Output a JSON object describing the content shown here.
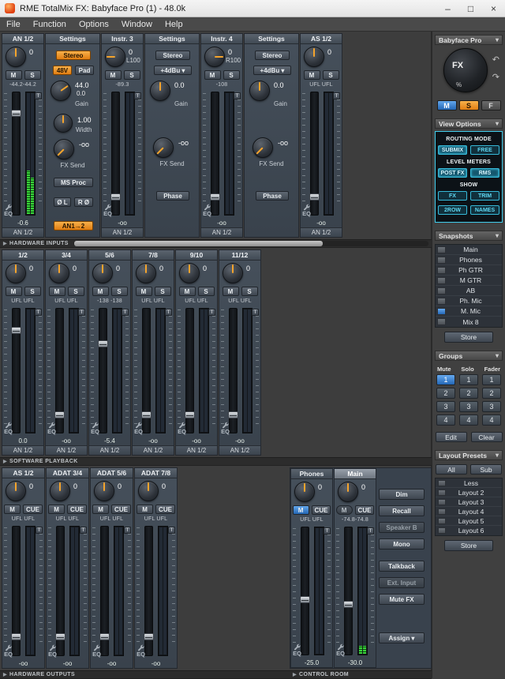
{
  "titlebar": {
    "title": "RME TotalMix FX: Babyface Pro (1) - 48.0k",
    "controls": [
      "–",
      "□",
      "×"
    ]
  },
  "menu": [
    "File",
    "Function",
    "Options",
    "Window",
    "Help"
  ],
  "ui": {
    "dropdown_arrow": "▾",
    "section_arrow": "▶"
  },
  "strip_common": {
    "trim": "T",
    "eq": "EQ"
  },
  "section_bars": {
    "hardware_inputs": "HARDWARE INPUTS",
    "software_playback": "SOFTWARE PLAYBACK",
    "hardware_outputs": "HARDWARE OUTPUTS",
    "control_room": "CONTROL ROOM"
  },
  "input_row": [
    {
      "kind": "strip",
      "name": "AN 1/2",
      "pan": "0",
      "buttons": [
        {
          "label": "M"
        },
        {
          "label": "S"
        }
      ],
      "levels": "-44.2-44.2",
      "fader_pos": 0.16,
      "meter": [
        0.36,
        0.3
      ],
      "value": "-0.6",
      "route": "AN 1/2"
    },
    {
      "kind": "settings_mic",
      "header": "Settings",
      "stereo": "Stereo",
      "phantom": "48V",
      "pad": "Pad",
      "gain_value1": "44.0",
      "gain_value2": "0.0",
      "gain_label": "Gain",
      "width_value": "1.00",
      "width_label": "Width",
      "fx_value": "-oo",
      "fx_label": "FX Send",
      "ms_proc": "MS Proc",
      "phase_l": "Ø L",
      "phase_r": "R Ø",
      "routing": "AN1→2"
    },
    {
      "kind": "strip",
      "name": "Instr. 3",
      "pan": "0",
      "pan2": "L100",
      "buttons": [
        {
          "label": "M"
        },
        {
          "label": "S"
        }
      ],
      "levels": "-89.3",
      "fader_pos": 0.92,
      "meter": [
        0,
        0
      ],
      "value": "-oo",
      "route": "AN 1/2"
    },
    {
      "kind": "settings_line",
      "header": "Settings",
      "stereo": "Stereo",
      "ref_level": "+4dBu ▾",
      "gain_value": "0.0",
      "gain_label": "Gain",
      "fx_value": "-oo",
      "fx_label": "FX Send",
      "phase": "Phase"
    },
    {
      "kind": "strip",
      "name": "Instr. 4",
      "pan": "0",
      "pan2": "R100",
      "buttons": [
        {
          "label": "M"
        },
        {
          "label": "S"
        }
      ],
      "levels": "-108",
      "fader_pos": 0.92,
      "meter": [
        0,
        0
      ],
      "value": "-oo",
      "route": "AN 1/2"
    },
    {
      "kind": "settings_line",
      "header": "Settings",
      "stereo": "Stereo",
      "ref_level": "+4dBu ▾",
      "gain_value": "0.0",
      "gain_label": "Gain",
      "fx_value": "-oo",
      "fx_label": "FX Send",
      "phase": "Phase"
    },
    {
      "kind": "strip",
      "name": "AS 1/2",
      "pan": "0",
      "buttons": [
        {
          "label": "M"
        },
        {
          "label": "S"
        }
      ],
      "levels": "UFL UFL",
      "fader_pos": 0.92,
      "meter": [
        0,
        0
      ],
      "value": "-oo",
      "route": "AN 1/2"
    }
  ],
  "playback_row": [
    {
      "name": "1/2",
      "pan": "0",
      "buttons": [
        {
          "label": "M"
        },
        {
          "label": "S"
        }
      ],
      "levels": "UFL UFL",
      "fader_pos": 0.16,
      "meter": [
        0,
        0
      ],
      "value": "0.0",
      "route": "AN 1/2"
    },
    {
      "name": "3/4",
      "pan": "0",
      "buttons": [
        {
          "label": "M"
        },
        {
          "label": "S"
        }
      ],
      "levels": "UFL UFL",
      "fader_pos": 0.92,
      "meter": [
        0,
        0
      ],
      "value": "-oo",
      "route": "AN 1/2"
    },
    {
      "name": "5/6",
      "pan": "0",
      "buttons": [
        {
          "label": "M"
        },
        {
          "label": "S"
        }
      ],
      "levels": "-138 -138",
      "fader_pos": 0.28,
      "meter": [
        0,
        0
      ],
      "value": "-5.4",
      "route": "AN 1/2"
    },
    {
      "name": "7/8",
      "pan": "0",
      "buttons": [
        {
          "label": "M"
        },
        {
          "label": "S"
        }
      ],
      "levels": "UFL UFL",
      "fader_pos": 0.92,
      "meter": [
        0,
        0
      ],
      "value": "-oo",
      "route": "AN 1/2"
    },
    {
      "name": "9/10",
      "pan": "0",
      "buttons": [
        {
          "label": "M"
        },
        {
          "label": "S"
        }
      ],
      "levels": "UFL UFL",
      "fader_pos": 0.92,
      "meter": [
        0,
        0
      ],
      "value": "-oo",
      "route": "AN 1/2"
    },
    {
      "name": "11/12",
      "pan": "0",
      "buttons": [
        {
          "label": "M"
        },
        {
          "label": "S"
        }
      ],
      "levels": "UFL UFL",
      "fader_pos": 0.92,
      "meter": [
        0,
        0
      ],
      "value": "-oo",
      "route": "AN 1/2"
    }
  ],
  "output_row": [
    {
      "name": "AS 1/2",
      "pan": "0",
      "buttons": [
        {
          "label": "M"
        },
        {
          "label": "CUE"
        }
      ],
      "levels": "UFL UFL",
      "fader_pos": 0.92,
      "meter": [
        0,
        0
      ],
      "value": "-oo"
    },
    {
      "name": "ADAT 3/4",
      "pan": "0",
      "buttons": [
        {
          "label": "M"
        },
        {
          "label": "CUE"
        }
      ],
      "levels": "UFL UFL",
      "fader_pos": 0.92,
      "meter": [
        0,
        0
      ],
      "value": "-oo"
    },
    {
      "name": "ADAT 5/6",
      "pan": "0",
      "buttons": [
        {
          "label": "M"
        },
        {
          "label": "CUE"
        }
      ],
      "levels": "UFL UFL",
      "fader_pos": 0.92,
      "meter": [
        0,
        0
      ],
      "value": "-oo"
    },
    {
      "name": "ADAT 7/8",
      "pan": "0",
      "buttons": [
        {
          "label": "M"
        },
        {
          "label": "CUE"
        }
      ],
      "levels": "UFL UFL",
      "fader_pos": 0.92,
      "meter": [
        0,
        0
      ],
      "value": "-oo"
    }
  ],
  "control_room": {
    "strips": [
      {
        "name": "Phones",
        "pan": "0",
        "buttons": [
          {
            "label": "M",
            "style": "blue"
          },
          {
            "label": "CUE"
          }
        ],
        "levels": "UFL UFL",
        "fader_pos": 0.6,
        "meter": [
          0,
          0
        ],
        "value": "-25.0"
      },
      {
        "name": "Main",
        "selected": true,
        "pan": "0",
        "buttons": [
          {
            "label": "M",
            "style": "circ"
          },
          {
            "label": "CUE"
          }
        ],
        "levels": "-74.8-74.8",
        "fader_pos": 0.64,
        "meter": [
          0.06,
          0.06
        ],
        "value": "-30.0"
      }
    ],
    "buttons": [
      {
        "label": "Dim"
      },
      {
        "label": "Recall"
      },
      {
        "label": "Speaker B",
        "dim": true
      },
      {
        "label": "Mono"
      },
      {
        "label": "Talkback"
      },
      {
        "label": "Ext. Input",
        "dim": true
      },
      {
        "label": "Mute FX"
      }
    ],
    "assign": "Assign ▾"
  },
  "sidebar": {
    "device": "Babyface Pro",
    "fx": {
      "label": "FX",
      "percent": "%",
      "prev_arrow": "↶",
      "next_arrow": "↷"
    },
    "msf": [
      {
        "label": "M",
        "color": "blue"
      },
      {
        "label": "S",
        "color": "orange"
      },
      {
        "label": "F",
        "color": "gray"
      }
    ],
    "view_options": {
      "header": "View Options",
      "routing_mode_label": "ROUTING MODE",
      "routing_buttons": [
        {
          "label": "SUBMIX",
          "active": true
        },
        {
          "label": "FREE"
        }
      ],
      "level_meters_label": "LEVEL METERS",
      "meter_buttons": [
        {
          "label": "POST FX",
          "active": true
        },
        {
          "label": "RMS",
          "active": true
        }
      ],
      "show_label": "SHOW",
      "show_buttons": [
        {
          "label": "FX"
        },
        {
          "label": "TRIM"
        },
        {
          "label": "2ROW"
        },
        {
          "label": "NAMES"
        }
      ]
    },
    "snapshots": {
      "header": "Snapshots",
      "items": [
        {
          "label": "Main"
        },
        {
          "label": "Phones"
        },
        {
          "label": "Ph GTR"
        },
        {
          "label": "M GTR"
        },
        {
          "label": "AB"
        },
        {
          "label": "Ph. Mic"
        },
        {
          "label": "M. Mic",
          "active": true
        },
        {
          "label": "Mix 8"
        }
      ],
      "store": "Store"
    },
    "groups": {
      "header": "Groups",
      "columns": [
        "Mute",
        "Solo",
        "Fader"
      ],
      "rows": [
        [
          "1",
          "1",
          "1"
        ],
        [
          "2",
          "2",
          "2"
        ],
        [
          "3",
          "3",
          "3"
        ],
        [
          "4",
          "4",
          "4"
        ]
      ],
      "active_cell": [
        0,
        0
      ],
      "edit": "Edit",
      "clear": "Clear"
    },
    "layout_presets": {
      "header": "Layout Presets",
      "tabs": [
        "All",
        "Sub"
      ],
      "items": [
        "Less",
        "Layout 2",
        "Layout 3",
        "Layout 4",
        "Layout 5",
        "Layout 6"
      ],
      "store": "Store"
    }
  }
}
